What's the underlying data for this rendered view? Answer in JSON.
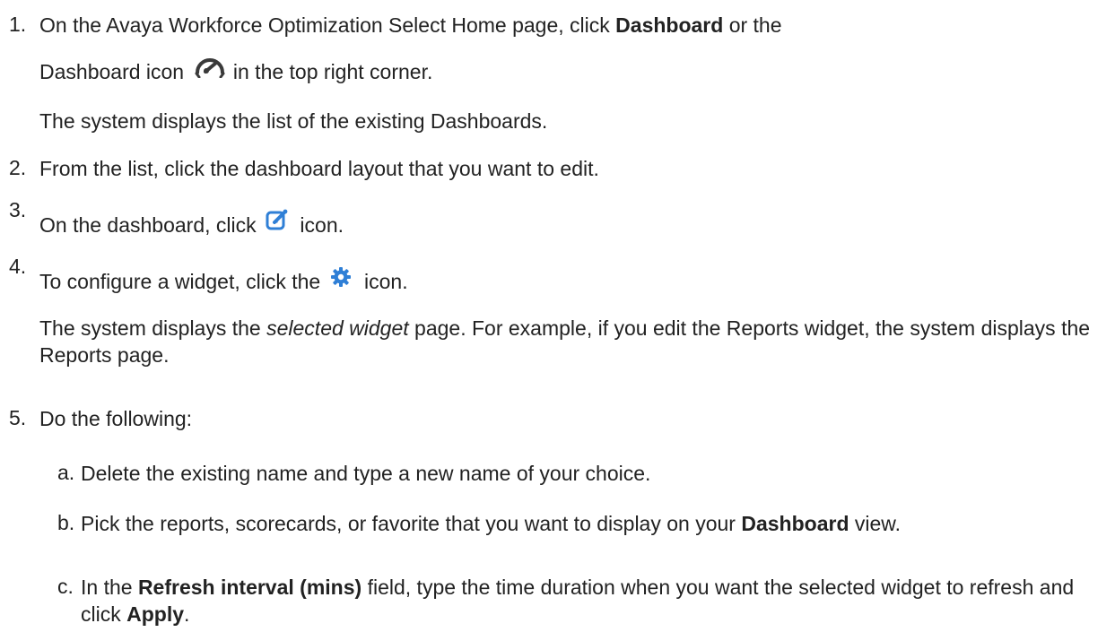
{
  "steps": [
    {
      "number": "1.",
      "line1": {
        "pre": "On the Avaya Workforce Optimization Select Home page, click ",
        "bold": "Dashboard",
        "post": " or the"
      },
      "line2": {
        "pre": "Dashboard icon",
        "post": " in the top right corner."
      },
      "result": "The system displays the list of the existing Dashboards.",
      "icon": "dashboard-gauge-icon"
    },
    {
      "number": "2.",
      "text": "From the list, click the dashboard layout that you want to edit."
    },
    {
      "number": "3.",
      "pre": "On the dashboard, click ",
      "post": " icon.",
      "icon": "edit-icon"
    },
    {
      "number": "4.",
      "pre": "To configure a widget, click the ",
      "post": " icon.",
      "icon": "gear-icon",
      "result": {
        "pre": "The system displays the ",
        "italic": "selected widget",
        "post": " page. For example, if you edit the Reports widget, the system displays the Reports page."
      }
    },
    {
      "number": "5.",
      "text": "Do the following:",
      "substeps": [
        {
          "letter": "a.",
          "text": "Delete the existing name and type a new name of your choice."
        },
        {
          "letter": "b.",
          "pre": "Pick the reports, scorecards, or favorite that you want to display on your ",
          "bold": "Dashboard",
          "post": " view."
        },
        {
          "letter": "c.",
          "pre": "In the ",
          "bold": "Refresh interval (mins)",
          "mid": " field, type the time duration when you want the selected widget to refresh and click ",
          "bold2": "Apply",
          "post": "."
        }
      ]
    }
  ],
  "colors": {
    "text": "#222222",
    "icon_blue": "#2f7fd6",
    "icon_dark": "#3a3a3a"
  }
}
